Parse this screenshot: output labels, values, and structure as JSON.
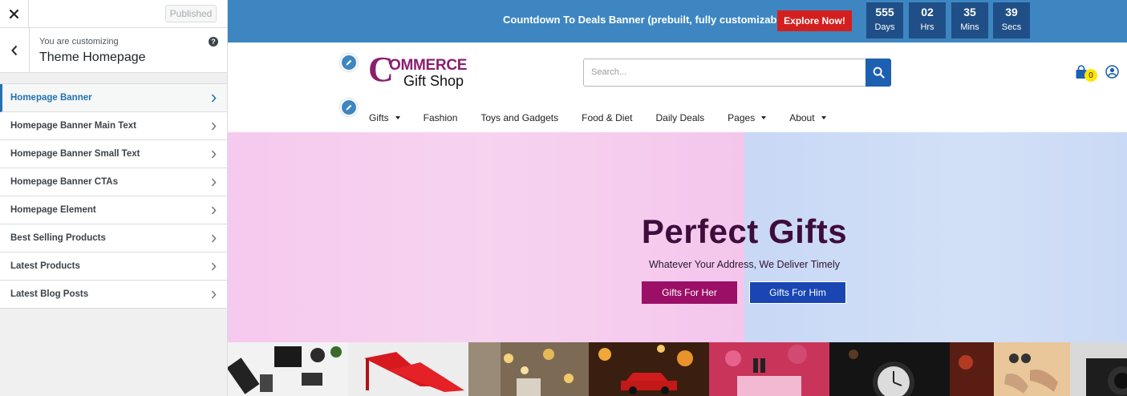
{
  "customizer": {
    "close_icon": "close-icon",
    "published_label": "Published",
    "customizing_label": "You are customizing",
    "section_title": "Theme Homepage",
    "help_label": "?",
    "items": [
      {
        "label": "Homepage Banner"
      },
      {
        "label": "Homepage Banner Main Text"
      },
      {
        "label": "Homepage Banner Small Text"
      },
      {
        "label": "Homepage Banner CTAs"
      },
      {
        "label": "Homepage Element"
      },
      {
        "label": "Best Selling Products"
      },
      {
        "label": "Latest Products"
      },
      {
        "label": "Latest Blog Posts"
      }
    ],
    "accent_color": "#2271b1"
  },
  "promo": {
    "text": "Countdown To Deals Banner (prebuilt, fully customizable)",
    "button_label": "Explore Now!",
    "countdown": [
      {
        "value": "555",
        "unit": "Days"
      },
      {
        "value": "02",
        "unit": "Hrs"
      },
      {
        "value": "35",
        "unit": "Mins"
      },
      {
        "value": "39",
        "unit": "Secs"
      }
    ],
    "bar_color": "#3d86c1",
    "button_color": "#d41f1f"
  },
  "header": {
    "logo": {
      "initial": "C",
      "word": "OMMERCE",
      "tagline": "Gift Shop"
    },
    "search_placeholder": "Search...",
    "cart_count": "0",
    "nav": [
      {
        "label": "Gifts",
        "dropdown": true
      },
      {
        "label": "Fashion",
        "dropdown": false
      },
      {
        "label": "Toys and Gadgets",
        "dropdown": false
      },
      {
        "label": "Food & Diet",
        "dropdown": false
      },
      {
        "label": "Daily Deals",
        "dropdown": false
      },
      {
        "label": "Pages",
        "dropdown": true
      },
      {
        "label": "About",
        "dropdown": true
      }
    ]
  },
  "hero": {
    "title": "Perfect Gifts",
    "subtitle": "Whatever Your Address, We Deliver Timely",
    "cta_her": "Gifts For Her",
    "cta_him": "Gifts For Him",
    "her_color": "#9b0f66",
    "him_color": "#1946b3"
  }
}
